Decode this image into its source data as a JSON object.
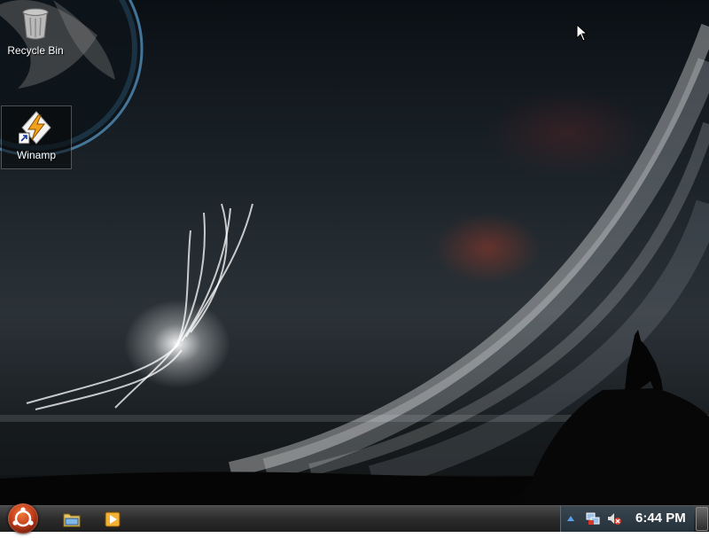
{
  "desktop": {
    "icons": [
      {
        "label": "Recycle Bin",
        "icon": "recycle-bin-icon"
      },
      {
        "label": "Winamp",
        "icon": "winamp-icon"
      }
    ]
  },
  "taskbar": {
    "start_icon": "start-orb-icon",
    "quick_launch": [
      {
        "icon": "folder-explorer-icon"
      },
      {
        "icon": "media-player-icon"
      }
    ],
    "tray": {
      "chevron_icon": "chevron-up-icon",
      "network_icon": "network-icon",
      "volume_icon": "volume-muted-icon"
    },
    "clock": "6:44 PM"
  },
  "colors": {
    "taskbar": "#2c2c2c",
    "tray": "#24303a",
    "start_orb": "#c43d1a",
    "winamp_bolt": "#f0a21a"
  }
}
